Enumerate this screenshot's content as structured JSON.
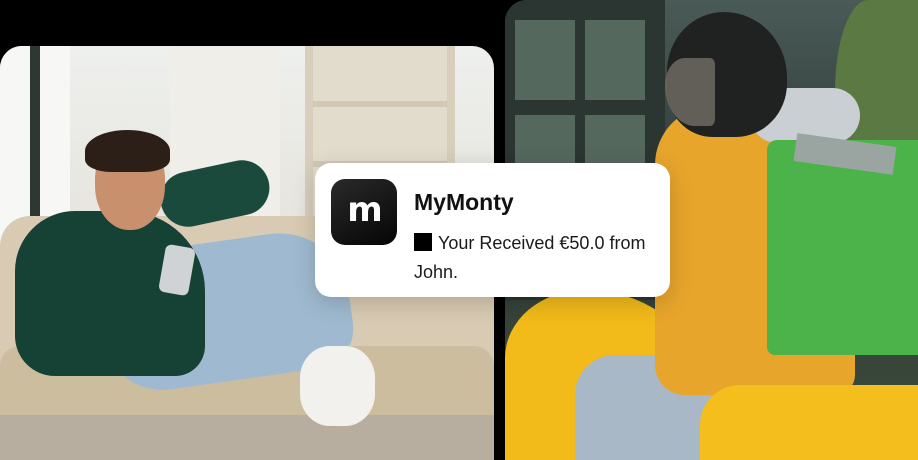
{
  "notification": {
    "app_icon_letter": "m",
    "app_name": "MyMonty",
    "message": "Your Received €50.0 from John.",
    "bullet_icon": "black-square-icon"
  },
  "colors": {
    "background": "#000000",
    "card": "#ffffff",
    "app_icon": "#111111",
    "bag_green": "#4cb34a",
    "jacket_yellow": "#e8a52c",
    "scooter_yellow": "#f2bb1a",
    "sweater_green": "#164236"
  }
}
